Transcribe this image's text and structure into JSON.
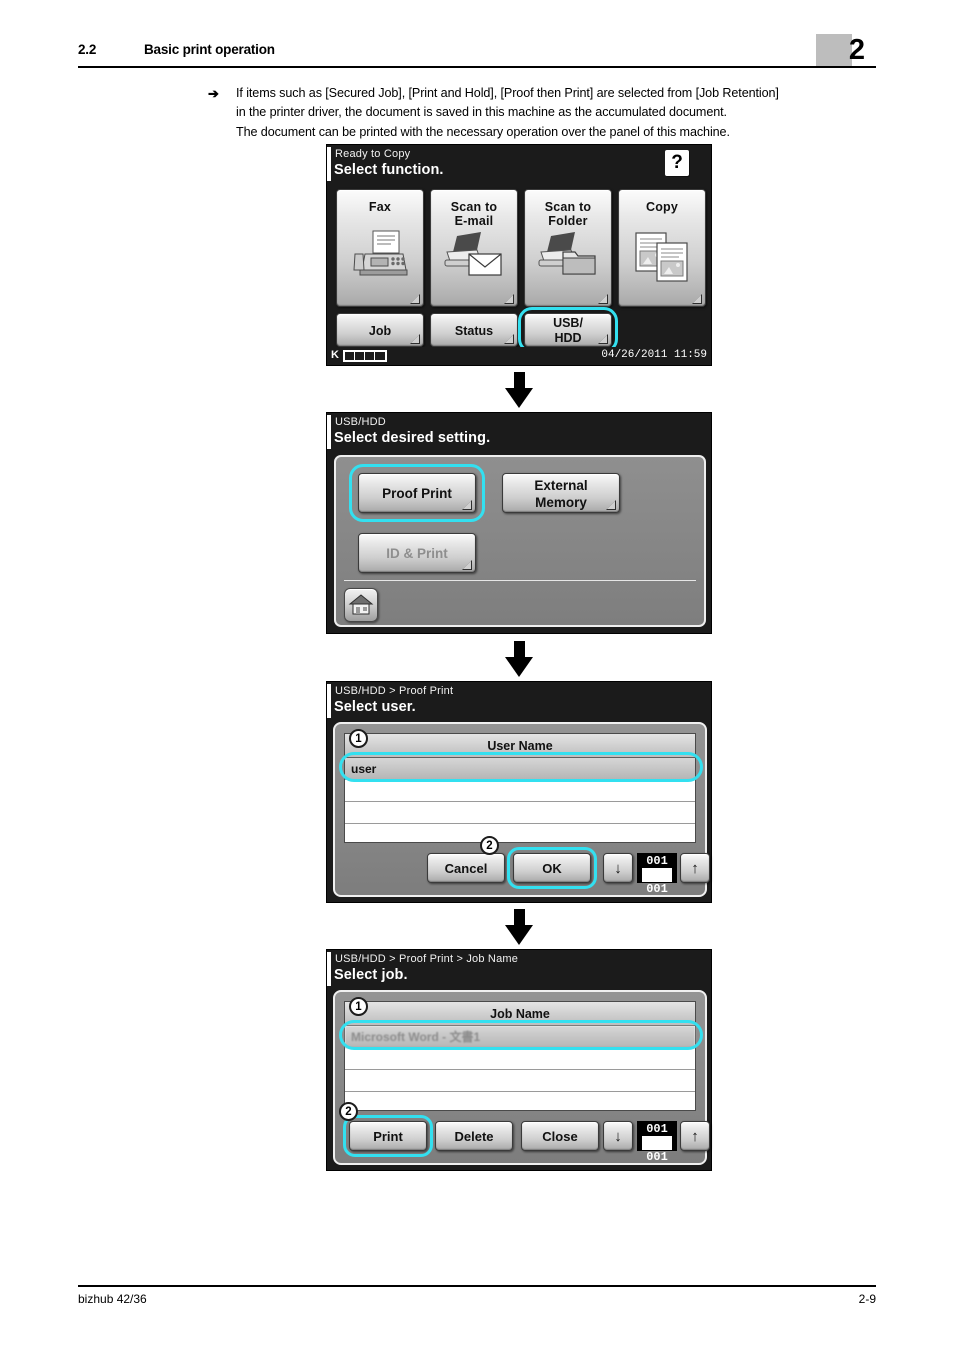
{
  "header": {
    "section_number": "2.2",
    "section_title": "Basic print operation",
    "chapter_number": "2"
  },
  "intro": {
    "arrow_glyph": "➔",
    "line1": "If items such as [Secured Job], [Print and Hold], [Proof then Print] are selected from [Job Retention]",
    "line2": "in the printer driver, the document is saved in this machine as the accumulated document.",
    "line3": "The document can be printed with the necessary operation over the panel of this machine."
  },
  "panels": {
    "panel1": {
      "status_line": "Ready to Copy",
      "prompt": "Select function.",
      "help_label": "?",
      "keys": [
        {
          "label": "Fax",
          "icon": "fax-machine-icon"
        },
        {
          "label_line1": "Scan to",
          "label_line2": "E-mail",
          "icon": "scanner-email-icon"
        },
        {
          "label_line1": "Scan to",
          "label_line2": "Folder",
          "icon": "scanner-folder-icon"
        },
        {
          "label": "Copy",
          "icon": "copy-documents-icon"
        }
      ],
      "bottom_keys": [
        {
          "label": "Job"
        },
        {
          "label": "Status"
        },
        {
          "label_line1": "USB/",
          "label_line2": "HDD",
          "highlighted": true
        }
      ],
      "toner_label": "K",
      "toner_segments": 4,
      "datetime": "04/26/2011  11:59"
    },
    "panel2": {
      "breadcrumb": "USB/HDD",
      "prompt": "Select desired setting.",
      "keys": [
        {
          "label": "Proof Print",
          "highlighted": true,
          "disabled": false
        },
        {
          "label_line1": "External",
          "label_line2": "Memory",
          "highlighted": false,
          "disabled": false
        },
        {
          "label": "ID & Print",
          "highlighted": false,
          "disabled": true
        }
      ],
      "home_icon": "home-icon"
    },
    "panel3": {
      "breadcrumb": "USB/HDD > Proof Print",
      "prompt": "Select user.",
      "column_header": "User Name",
      "rows": [
        "user",
        "",
        "",
        ""
      ],
      "selected_row_index": 0,
      "buttons": [
        {
          "label": "Cancel",
          "highlighted": false
        },
        {
          "label": "OK",
          "highlighted": true
        }
      ],
      "nav_down": "↓",
      "nav_up": "↑",
      "page_current": "001",
      "page_total": "001",
      "callouts": [
        "1",
        "2"
      ]
    },
    "panel4": {
      "breadcrumb": "USB/HDD > Proof Print > Job Name",
      "prompt": "Select job.",
      "column_header": "Job Name",
      "rows": [
        "Microsoft Word - 文書1",
        "",
        "",
        ""
      ],
      "selected_row_index": 0,
      "buttons": [
        {
          "label": "Print",
          "highlighted": true
        },
        {
          "label": "Delete",
          "highlighted": false
        },
        {
          "label": "Close",
          "highlighted": false
        }
      ],
      "nav_down": "↓",
      "nav_up": "↑",
      "page_current": "001",
      "page_total": "001",
      "callouts": [
        "1",
        "2"
      ]
    }
  },
  "footer": {
    "product": "bizhub 42/36",
    "page_number": "2-9"
  },
  "colors": {
    "highlight_ring": "#33e0f0",
    "lcd_background": "#1b1b1b",
    "chapter_box": "#bdbdbd"
  }
}
